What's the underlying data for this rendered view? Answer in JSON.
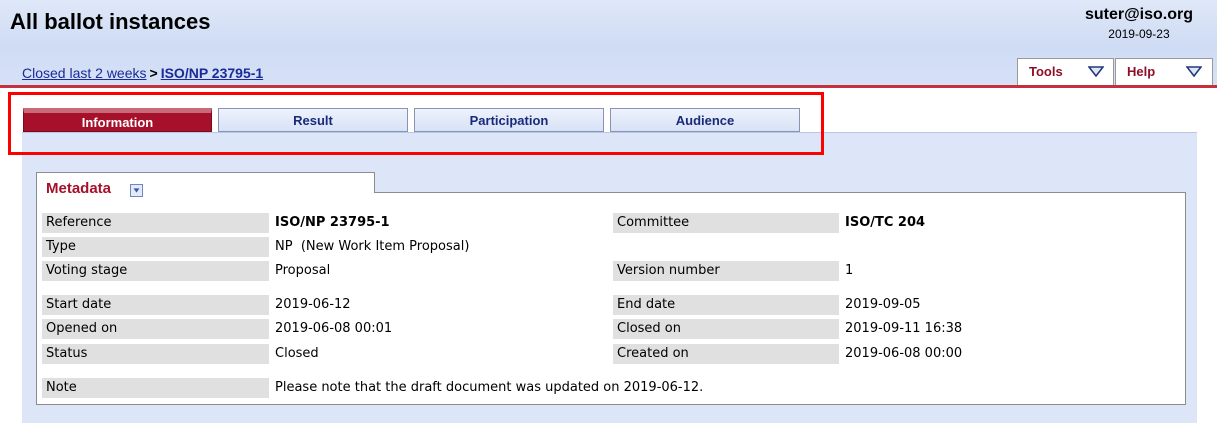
{
  "header": {
    "title": "All ballot instances",
    "user_email": "suter@iso.org",
    "user_date": "2019-09-23"
  },
  "breadcrumb": {
    "parent": "Closed last 2 weeks",
    "separator": ">",
    "current": "ISO/NP 23795-1"
  },
  "menus": {
    "tools": "Tools",
    "help": "Help"
  },
  "tabs": {
    "information": "Information",
    "result": "Result",
    "participation": "Participation",
    "audience": "Audience"
  },
  "metadata": {
    "title": "Metadata",
    "reference_label": "Reference",
    "reference_value": "ISO/NP 23795-1",
    "committee_label": "Committee",
    "committee_value": "ISO/TC 204",
    "type_label": "Type",
    "type_value": "NP  (New Work Item Proposal)",
    "voting_stage_label": "Voting stage",
    "voting_stage_value": "Proposal",
    "version_label": "Version number",
    "version_value": "1",
    "start_date_label": "Start date",
    "start_date_value": "2019-06-12",
    "end_date_label": "End date",
    "end_date_value": "2019-09-05",
    "opened_on_label": "Opened on",
    "opened_on_value": "2019-06-08 00:01",
    "closed_on_label": "Closed on",
    "closed_on_value": "2019-09-11 16:38",
    "status_label": "Status",
    "status_value": "Closed",
    "created_on_label": "Created on",
    "created_on_value": "2019-06-08 00:00",
    "note_label": "Note",
    "note_value": "Please note that the draft document was updated on 2019-06-12."
  },
  "colors": {
    "accent_red": "#a6102a",
    "header_blue": "#cfdcf4",
    "highlight": "#ff0000"
  }
}
